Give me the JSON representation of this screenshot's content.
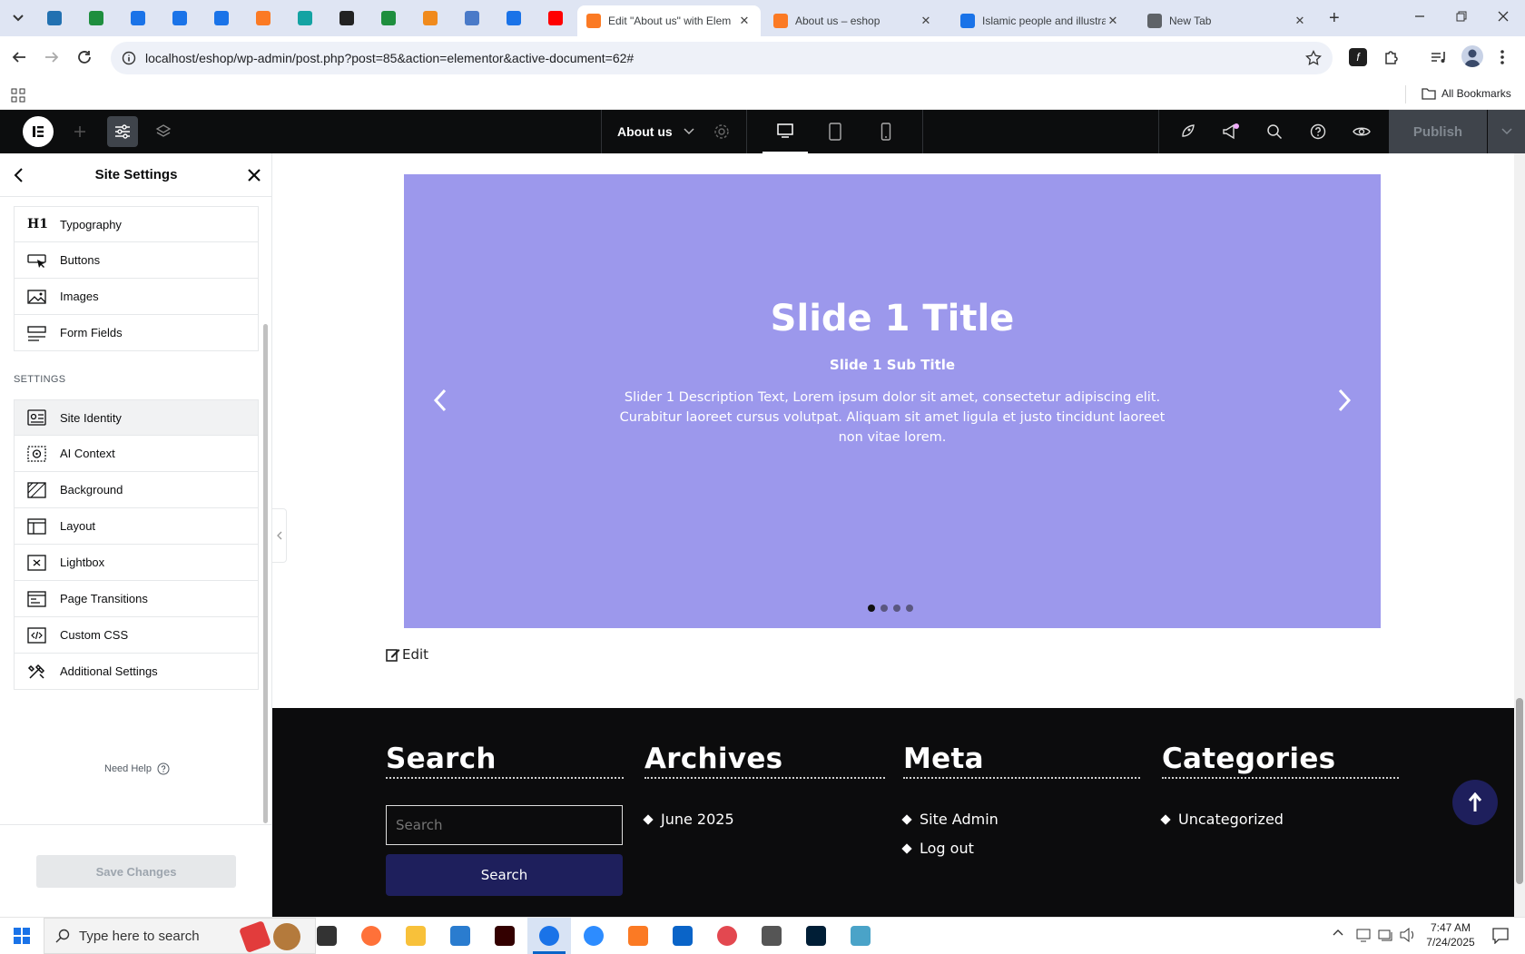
{
  "browser": {
    "pinned": [
      {
        "icon": "wordpress-icon",
        "color": "#2271b1"
      },
      {
        "icon": "sheets-icon",
        "color": "#1e8e3e"
      },
      {
        "icon": "docs-icon",
        "color": "#1a73e8"
      },
      {
        "icon": "docs-icon",
        "color": "#1a73e8"
      },
      {
        "icon": "docs-icon",
        "color": "#1a73e8"
      },
      {
        "icon": "xampp-icon",
        "color": "#fb7a24"
      },
      {
        "icon": "app-icon",
        "color": "#14a3a3"
      },
      {
        "icon": "openai-icon",
        "color": "#222"
      },
      {
        "icon": "sheets-icon",
        "color": "#1e8e3e"
      },
      {
        "icon": "java-icon",
        "color": "#f08a1c"
      },
      {
        "icon": "grid-app-icon",
        "color": "#4a7ac8"
      },
      {
        "icon": "forms-icon",
        "color": "#1a73e8"
      },
      {
        "icon": "youtube-icon",
        "color": "#ff0000"
      }
    ],
    "tabs": [
      {
        "title": "Edit \"About us\" with Elem",
        "color": "#fb7a24",
        "active": true
      },
      {
        "title": "About us – eshop",
        "color": "#fb7a24",
        "active": false
      },
      {
        "title": "Islamic people and illustra",
        "color": "#1a73e8",
        "active": false
      },
      {
        "title": "New Tab",
        "color": "#5f6368",
        "active": false
      }
    ],
    "url": "localhost/eshop/wp-admin/post.php?post=85&action=elementor&active-document=62#",
    "all_bookmarks": "All Bookmarks"
  },
  "editor": {
    "document_title": "About us",
    "publish_label": "Publish"
  },
  "panel": {
    "title": "Site Settings",
    "design_items": [
      {
        "label": "Typography",
        "icon": "h1-icon"
      },
      {
        "label": "Buttons",
        "icon": "button-cursor-icon"
      },
      {
        "label": "Images",
        "icon": "image-icon"
      },
      {
        "label": "Form Fields",
        "icon": "form-fields-icon"
      }
    ],
    "section_label": "SETTINGS",
    "settings_items": [
      {
        "label": "Site Identity",
        "icon": "site-identity-icon"
      },
      {
        "label": "AI Context",
        "icon": "ai-context-icon"
      },
      {
        "label": "Background",
        "icon": "background-icon"
      },
      {
        "label": "Layout",
        "icon": "layout-icon"
      },
      {
        "label": "Lightbox",
        "icon": "lightbox-icon"
      },
      {
        "label": "Page Transitions",
        "icon": "page-transitions-icon"
      },
      {
        "label": "Custom CSS",
        "icon": "code-icon"
      },
      {
        "label": "Additional Settings",
        "icon": "tools-icon"
      }
    ],
    "need_help": "Need Help",
    "save_label": "Save Changes"
  },
  "slide": {
    "title": "Slide 1 Title",
    "subtitle": "Slide 1 Sub Title",
    "description": "Slider 1 Description Text, Lorem ipsum dolor sit amet, consectetur adipiscing elit. Curabitur laoreet cursus volutpat. Aliquam sit amet ligula et justo tincidunt laoreet non vitae lorem.",
    "background": "#9c98ec"
  },
  "edit_link": "Edit",
  "footer": {
    "search_heading": "Search",
    "search_placeholder": "Search",
    "search_button": "Search",
    "archives_heading": "Archives",
    "archives": [
      "June 2025"
    ],
    "meta_heading": "Meta",
    "meta": [
      "Site Admin",
      "Log out"
    ],
    "categories_heading": "Categories",
    "categories": [
      "Uncategorized"
    ]
  },
  "taskbar": {
    "search_placeholder": "Type here to search",
    "time": "7:47 AM",
    "date": "7/24/2025",
    "apps": [
      {
        "icon": "task-view-icon",
        "color": "#333",
        "on": false
      },
      {
        "icon": "firefox-icon",
        "color": "#ff7139",
        "on": false
      },
      {
        "icon": "file-explorer-icon",
        "color": "#f8c13a",
        "on": false
      },
      {
        "icon": "vscode-icon",
        "color": "#2a7ccf",
        "on": false
      },
      {
        "icon": "illustrator-icon",
        "color": "#330000",
        "on": false
      },
      {
        "icon": "chrome-icon",
        "color": "#1a73e8",
        "on": true
      },
      {
        "icon": "zoom-icon",
        "color": "#2d8cff",
        "on": false
      },
      {
        "icon": "xampp-icon",
        "color": "#fb7a24",
        "on": false
      },
      {
        "icon": "outlook-icon",
        "color": "#0a64c8",
        "on": false
      },
      {
        "icon": "creative-cloud-icon",
        "color": "#e34850",
        "on": false
      },
      {
        "icon": "pen-tool-icon",
        "color": "#555",
        "on": false
      },
      {
        "icon": "photoshop-icon",
        "color": "#001e36",
        "on": false
      },
      {
        "icon": "app-icon",
        "color": "#4aa3c8",
        "on": false
      }
    ]
  }
}
